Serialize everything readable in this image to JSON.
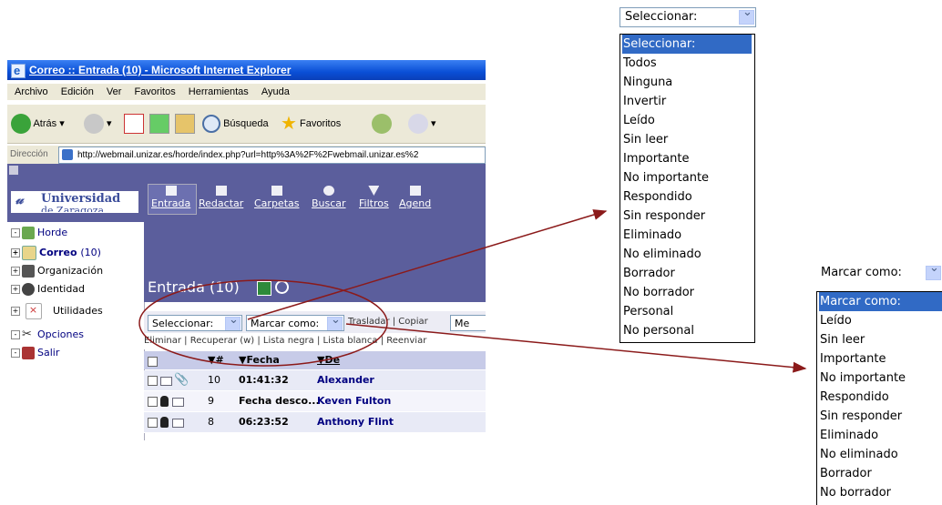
{
  "window": {
    "title": "Correo :: Entrada (10) - Microsoft Internet Explorer",
    "menu": [
      "Archivo",
      "Edición",
      "Ver",
      "Favoritos",
      "Herramientas",
      "Ayuda"
    ],
    "toolbar": {
      "back": "Atrás",
      "search": "Búsqueda",
      "favorites": "Favoritos"
    },
    "address": {
      "label": "Dirección",
      "url": "http://webmail.unizar.es/horde/index.php?url=http%3A%2F%2Fwebmail.unizar.es%2"
    }
  },
  "sidebar": {
    "logo": {
      "name": "Universidad",
      "sub": "de Zaragoza"
    },
    "items": [
      {
        "label": "Horde",
        "icon": "horde-icon"
      },
      {
        "label": "Correo",
        "count": "(10)",
        "icon": "mail-icon"
      },
      {
        "label": "Organización",
        "icon": "organization-icon"
      },
      {
        "label": "Identidad",
        "icon": "identity-icon"
      },
      {
        "label": "Utilidades",
        "icon": "utilities-icon"
      },
      {
        "label": "Opciones",
        "icon": "options-icon"
      },
      {
        "label": "Salir",
        "icon": "exit-icon"
      }
    ]
  },
  "nav": {
    "items": [
      "Entrada",
      "Redactar",
      "Carpetas",
      "Buscar",
      "Filtros",
      "Agend"
    ]
  },
  "folder": {
    "title": "Entrada (10)"
  },
  "selectors": {
    "select_value": "Seleccionar:",
    "mark_value": "Marcar como:",
    "links": "Trasladar | Copiar",
    "move_target": "Me"
  },
  "actions": "Eliminar | Recuperar (w) | Lista negra | Lista blanca | Reenviar",
  "table": {
    "headers": [
      "#",
      "Fecha",
      "De"
    ],
    "rows": [
      {
        "num": "10",
        "date": "01:41:32",
        "from": "Alexander"
      },
      {
        "num": "9",
        "date": "Fecha desco...",
        "from": "Keven Fulton"
      },
      {
        "num": "8",
        "date": "06:23:52",
        "from": "Anthony Flint"
      }
    ]
  },
  "select_dropdown": {
    "value": "Seleccionar:",
    "options": [
      "Seleccionar:",
      "Todos",
      "Ninguna",
      "Invertir",
      "Leído",
      "Sin leer",
      "Importante",
      "No importante",
      "Respondido",
      "Sin responder",
      "Eliminado",
      "No eliminado",
      "Borrador",
      "No borrador",
      "Personal",
      "No personal"
    ]
  },
  "mark_dropdown": {
    "value": "Marcar como:",
    "options": [
      "Marcar como:",
      "Leído",
      "Sin leer",
      "Importante",
      "No importante",
      "Respondido",
      "Sin responder",
      "Eliminado",
      "No eliminado",
      "Borrador",
      "No borrador"
    ]
  },
  "colors": {
    "accent": "#5b5e9c",
    "highlight": "#316ac5",
    "arrow": "#8b1a1a"
  }
}
